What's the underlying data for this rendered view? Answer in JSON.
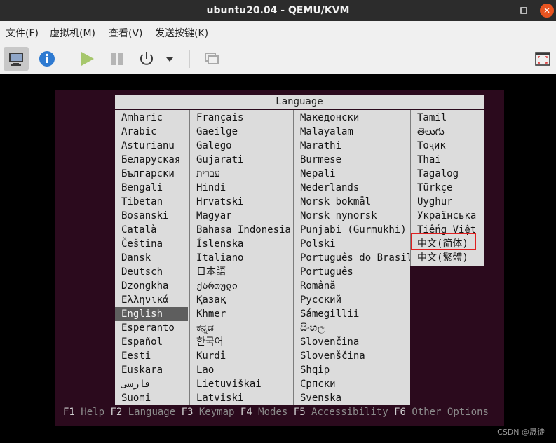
{
  "window": {
    "title": "ubuntu20.04 - QEMU/KVM"
  },
  "menubar": [
    "文件(F)",
    "虚拟机(M)",
    "查看(V)",
    "发送按键(K)"
  ],
  "toolbar": {
    "icons": [
      "console-icon",
      "info-icon",
      "run-icon",
      "pause-icon",
      "power-icon",
      "dropdown-icon",
      "snapshot-icon",
      "fullscreen-icon"
    ]
  },
  "installer": {
    "title": "Language",
    "selected": "English",
    "highlighted": "中文(简体)",
    "columns": [
      [
        "Amharic",
        "Arabic",
        "Asturianu",
        "Беларуская",
        "Български",
        "Bengali",
        "Tibetan",
        "Bosanski",
        "Català",
        "Čeština",
        "Dansk",
        "Deutsch",
        "Dzongkha",
        "Ελληνικά",
        "English",
        "Esperanto",
        "Español",
        "Eesti",
        "Euskara",
        "فارسی",
        "Suomi"
      ],
      [
        "Français",
        "Gaeilge",
        "Galego",
        "Gujarati",
        "עברית",
        "Hindi",
        "Hrvatski",
        "Magyar",
        "Bahasa Indonesia",
        "Íslenska",
        "Italiano",
        "日本語",
        "ქართული",
        "Қазақ",
        "Khmer",
        "ಕನ್ನಡ",
        "한국어",
        "Kurdî",
        "Lao",
        "Lietuviškai",
        "Latviski"
      ],
      [
        "Македонски",
        "Malayalam",
        "Marathi",
        "Burmese",
        "Nepali",
        "Nederlands",
        "Norsk bokmål",
        "Norsk nynorsk",
        "Punjabi (Gurmukhi)",
        "Polski",
        "Português do Brasil",
        "Português",
        "Română",
        "Русский",
        "Sámegillii",
        "සිංහල",
        "Slovenčina",
        "Slovenščina",
        "Shqip",
        "Српски",
        "Svenska"
      ],
      [
        "Tamil",
        "తెలుగు",
        "Тоҷик",
        "Thai",
        "Tagalog",
        "Türkçe",
        "Uyghur",
        "Українська",
        "Tiếng Việt",
        "中文(简体)",
        "中文(繁體)"
      ]
    ]
  },
  "fkeys": [
    {
      "key": "F1",
      "label": "Help"
    },
    {
      "key": "F2",
      "label": "Language"
    },
    {
      "key": "F3",
      "label": "Keymap"
    },
    {
      "key": "F4",
      "label": "Modes"
    },
    {
      "key": "F5",
      "label": "Accessibility"
    },
    {
      "key": "F6",
      "label": "Other Options"
    }
  ],
  "watermark": "CSDN @晟徒",
  "colors": {
    "titlebar": "#2c2c2c",
    "close": "#e95420",
    "screen_bg": "#2b0a1d",
    "panel": "#dcdcdc",
    "selected": "#5e5e5e",
    "highlight_box": "#e02020"
  }
}
